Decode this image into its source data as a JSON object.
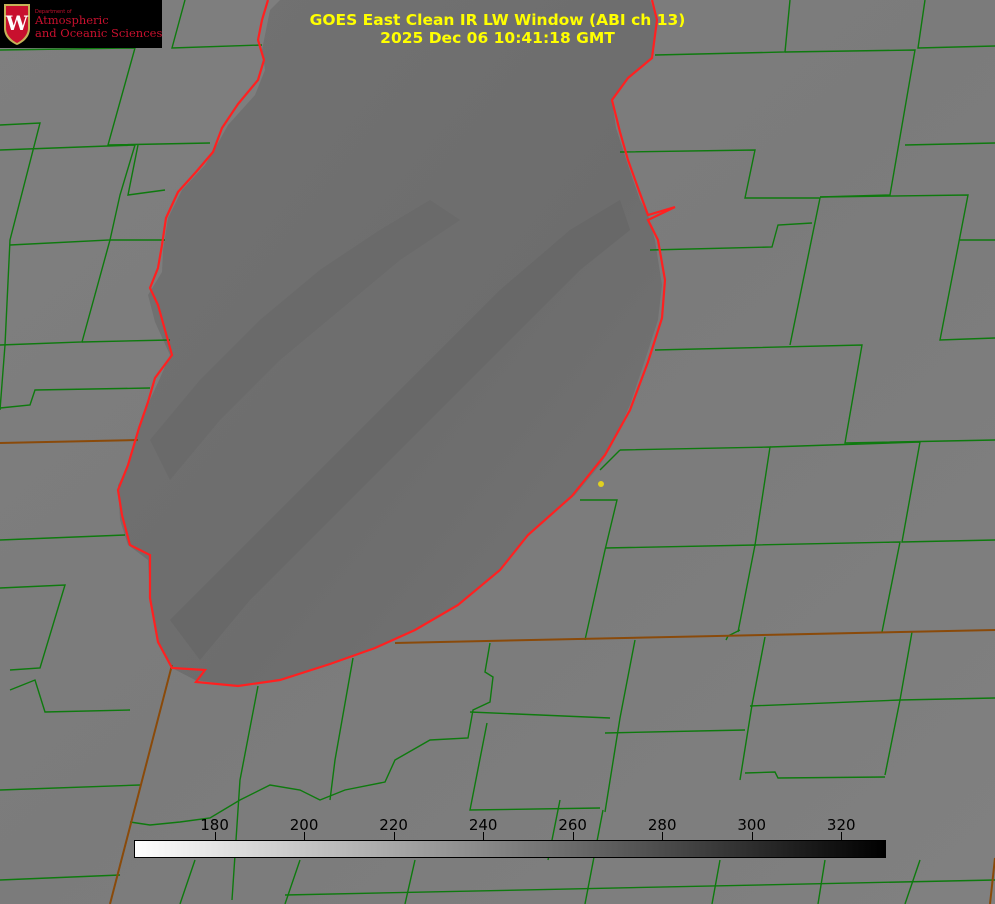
{
  "title": {
    "line1": "GOES East Clean IR LW Window (ABI ch 13)",
    "line2": "2025 Dec 06 10:41:18 GMT"
  },
  "logo": {
    "department": "Department of",
    "line1": "Atmospheric",
    "line2": "and Oceanic Sciences",
    "crest_letter": "W"
  },
  "colorbar": {
    "min": 162,
    "max": 330,
    "ticks": [
      "180",
      "200",
      "220",
      "240",
      "260",
      "280",
      "300",
      "320"
    ],
    "tick_values": [
      180,
      200,
      220,
      240,
      260,
      280,
      300,
      320
    ],
    "gradient": [
      "#ffffff",
      "#000000"
    ]
  },
  "colors": {
    "background": "#7c7c7c",
    "lake": "#6e6e6e",
    "county_lines": "#0e7a0e",
    "state_lines": "#8a4a0a",
    "coastline": "#ff2020",
    "title_text": "#ffff00",
    "station_dot": "#e0d020"
  }
}
